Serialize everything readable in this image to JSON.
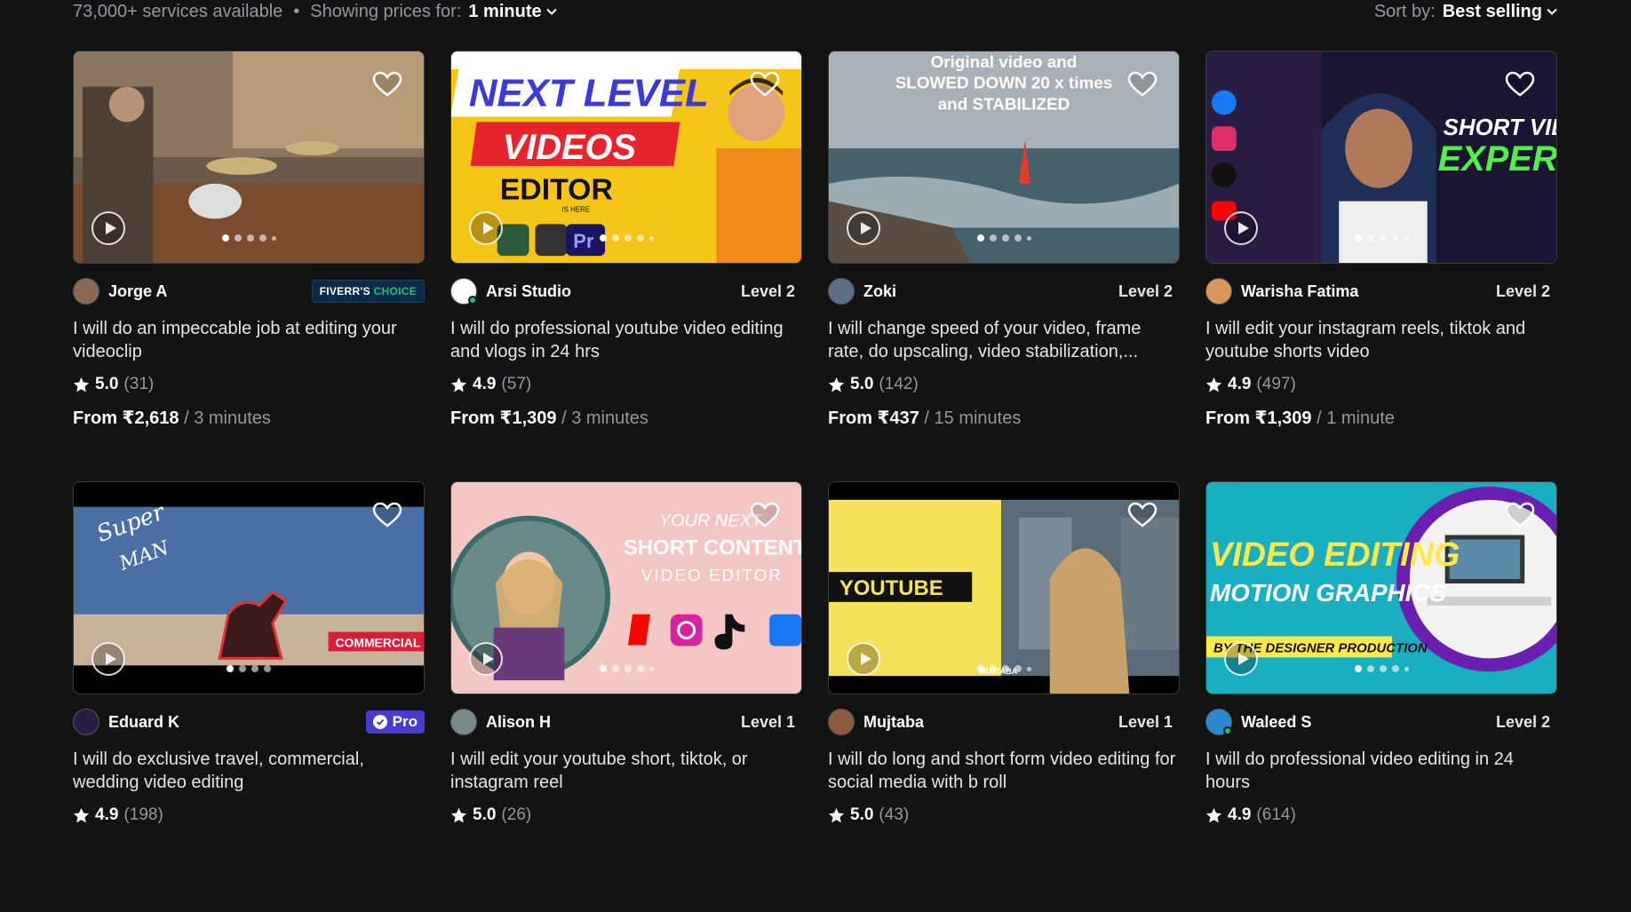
{
  "topbar": {
    "services": "73,000+ services available",
    "showing_label": "Showing prices for:",
    "showing_value": "1 minute",
    "sort_label": "Sort by:",
    "sort_value": "Best selling"
  },
  "cards": [
    {
      "seller": "Jorge A",
      "level": "",
      "badge": "choice",
      "badge_a": "FIVERR'S",
      "badge_b": "CHOICE",
      "title": "I will do an impeccable job at editing your videoclip",
      "score": "5.0",
      "count": "(31)",
      "price": "From ₹2,618",
      "unit": "/ 3 minutes",
      "thumb_text": []
    },
    {
      "seller": "Arsi Studio",
      "level": "Level 2",
      "badge": "",
      "title": "I will do professional youtube video editing and vlogs in 24 hrs",
      "score": "4.9",
      "count": "(57)",
      "price": "From ₹1,309",
      "unit": "/ 3 minutes",
      "thumb_text": [
        "NEXT LEVEL",
        "VIDEOS",
        "EDITOR",
        "IS HERE",
        "Pr"
      ]
    },
    {
      "seller": "Zoki",
      "level": "Level 2",
      "badge": "",
      "title": "I will change speed of your video, frame rate, do upscaling, video stabilization,...",
      "score": "5.0",
      "count": "(142)",
      "price": "From ₹437",
      "unit": "/ 15 minutes",
      "thumb_text": [
        "Original video and",
        "SLOWED DOWN 20 x times",
        "and STABILIZED"
      ]
    },
    {
      "seller": "Warisha Fatima",
      "level": "Level 2",
      "badge": "",
      "title": "I will edit your instagram reels, tiktok and youtube shorts video",
      "score": "4.9",
      "count": "(497)",
      "price": "From ₹1,309",
      "unit": "/ 1 minute",
      "thumb_text": [
        "SHORT VID",
        "EXPER"
      ]
    },
    {
      "seller": "Eduard K",
      "level": "",
      "badge": "pro",
      "badge_a": "Pro",
      "title": "I will do exclusive travel, commercial, wedding video editing",
      "score": "4.9",
      "count": "(198)",
      "price": "",
      "unit": "",
      "thumb_text": [
        "Super",
        "MAN",
        "COMMERCIAL"
      ]
    },
    {
      "seller": "Alison H",
      "level": "Level 1",
      "badge": "",
      "title": "I will edit your youtube short, tiktok, or instagram reel",
      "score": "5.0",
      "count": "(26)",
      "price": "",
      "unit": "",
      "thumb_text": [
        "YOUR NEXT",
        "SHORT CONTENT",
        "VIDEO EDITOR"
      ]
    },
    {
      "seller": "Mujtaba",
      "level": "Level 1",
      "badge": "",
      "title": "I will do long and short form video editing for social media with b roll",
      "score": "5.0",
      "count": "(43)",
      "price": "",
      "unit": "",
      "thumb_text": [
        "YOUTUBE",
        "MUJTABA"
      ]
    },
    {
      "seller": "Waleed S",
      "level": "Level 2",
      "badge": "",
      "title": "I will do professional video editing in 24 hours",
      "score": "4.9",
      "count": "(614)",
      "price": "",
      "unit": "",
      "thumb_text": [
        "VIDEO EDITING",
        "MOTION GRAPHICS",
        "BY THE DESIGNER PRODUCTION"
      ]
    }
  ],
  "colors": {
    "bg": "#131313",
    "green": "#1dbf73",
    "pro": "#4a3bcf"
  }
}
